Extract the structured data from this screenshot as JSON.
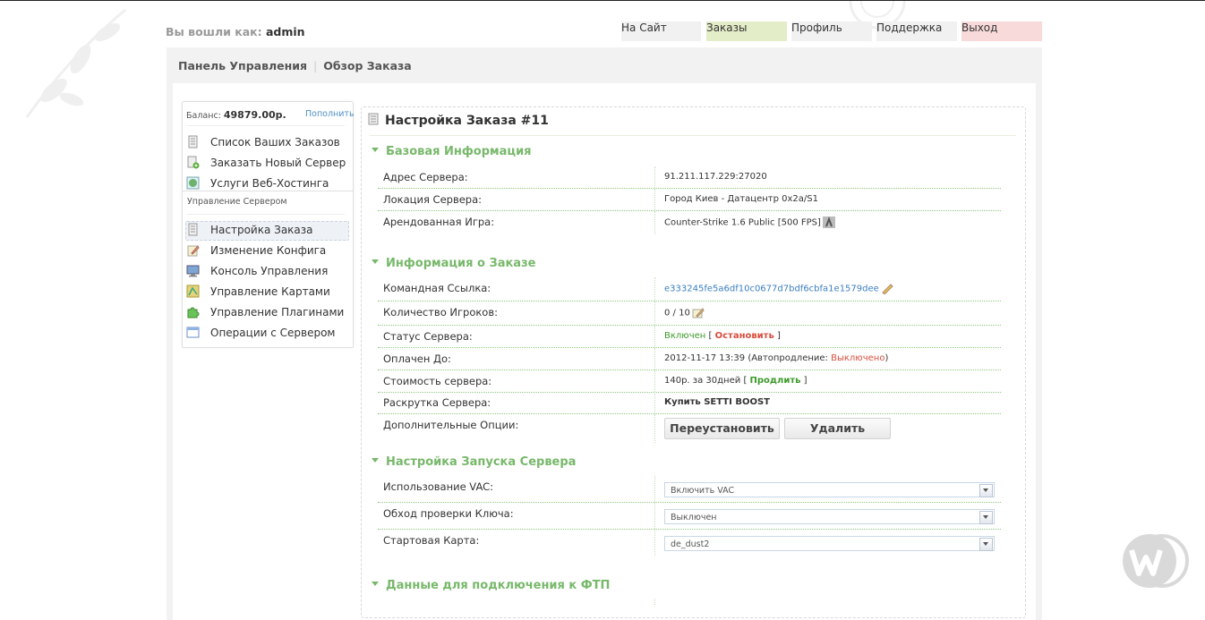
{
  "header": {
    "login_prefix": "Вы вошли как:",
    "username": "admin",
    "nav": [
      {
        "label": "На Сайт",
        "bg": "#f1f1f1"
      },
      {
        "label": "Заказы",
        "bg": "#e3edc7"
      },
      {
        "label": "Профиль",
        "bg": "#f1f1f1"
      },
      {
        "label": "Поддержка",
        "bg": "#f1f1f1"
      },
      {
        "label": "Выход",
        "bg": "#f8dada"
      }
    ]
  },
  "breadcrumb": {
    "first": "Панель Управления",
    "second": "Обзор Заказа"
  },
  "sidebar": {
    "balance_label": "Баланс:",
    "balance_value": "49879.00р.",
    "topup_label": "Пополнить",
    "items": [
      {
        "label": "Список Ваших Заказов",
        "icon": "document-icon"
      },
      {
        "label": "Заказать Новый Сервер",
        "icon": "add-server-icon"
      },
      {
        "label": "Услуги Веб-Хостинга",
        "icon": "globe-icon"
      }
    ],
    "section_title": "Управление Сервером",
    "server_items": [
      {
        "label": "Настройка Заказа",
        "icon": "document-icon",
        "active": true
      },
      {
        "label": "Изменение Конфига",
        "icon": "edit-config-icon"
      },
      {
        "label": "Консоль Управления",
        "icon": "monitor-icon"
      },
      {
        "label": "Управление Картами",
        "icon": "map-icon"
      },
      {
        "label": "Управление Плагинами",
        "icon": "puzzle-icon"
      },
      {
        "label": "Операции с Сервером",
        "icon": "window-icon"
      }
    ]
  },
  "main": {
    "title": "Настройка Заказа #11",
    "sections": {
      "basic": "Базовая Информация",
      "order": "Информация о Заказе",
      "launch": "Настройка Запуска Сервера",
      "ftp": "Данные для подключения к ФТП"
    },
    "basic": {
      "address_label": "Адрес Сервера:",
      "address_value": "91.211.117.229:27020",
      "location_label": "Локация Сервера:",
      "location_value": "Город Киев - Датацентр 0x2a/S1",
      "game_label": "Арендованная Игра:",
      "game_value": "Counter-Strike 1.6 Public [500 FPS]"
    },
    "order": {
      "cmdlink_label": "Командная Ссылка:",
      "cmdlink_value": "e333245fe5a6df10c0677d7bdf6cbfa1e1579dee",
      "players_label": "Количество Игроков:",
      "players_value": "0 / 10",
      "status_label": "Статус Сервера:",
      "status_value": "Включен",
      "status_open": "[",
      "status_action": "Остановить",
      "status_close": "]",
      "paid_label": "Оплачен До:",
      "paid_date": "2012-11-17 13:39",
      "paid_auto_prefix": "(Автопродление:",
      "paid_auto_value": "Выключено",
      "paid_auto_suffix": ")",
      "cost_label": "Стоимость сервера:",
      "cost_value": "140р. за 30дней",
      "cost_open": "[",
      "cost_action": "Продлить",
      "cost_close": "]",
      "promo_label": "Раскрутка Сервера:",
      "promo_value": "Купить SETTI BOOST",
      "options_label": "Дополнительные Опции:",
      "reinstall_button": "Переустановить",
      "delete_button": "Удалить"
    },
    "launch": {
      "vac_label": "Использование VAC:",
      "vac_value": "Включить VAC",
      "key_label": "Обход проверки Ключа:",
      "key_value": "Выключен",
      "map_label": "Стартовая Карта:",
      "map_value": "de_dust2"
    }
  }
}
